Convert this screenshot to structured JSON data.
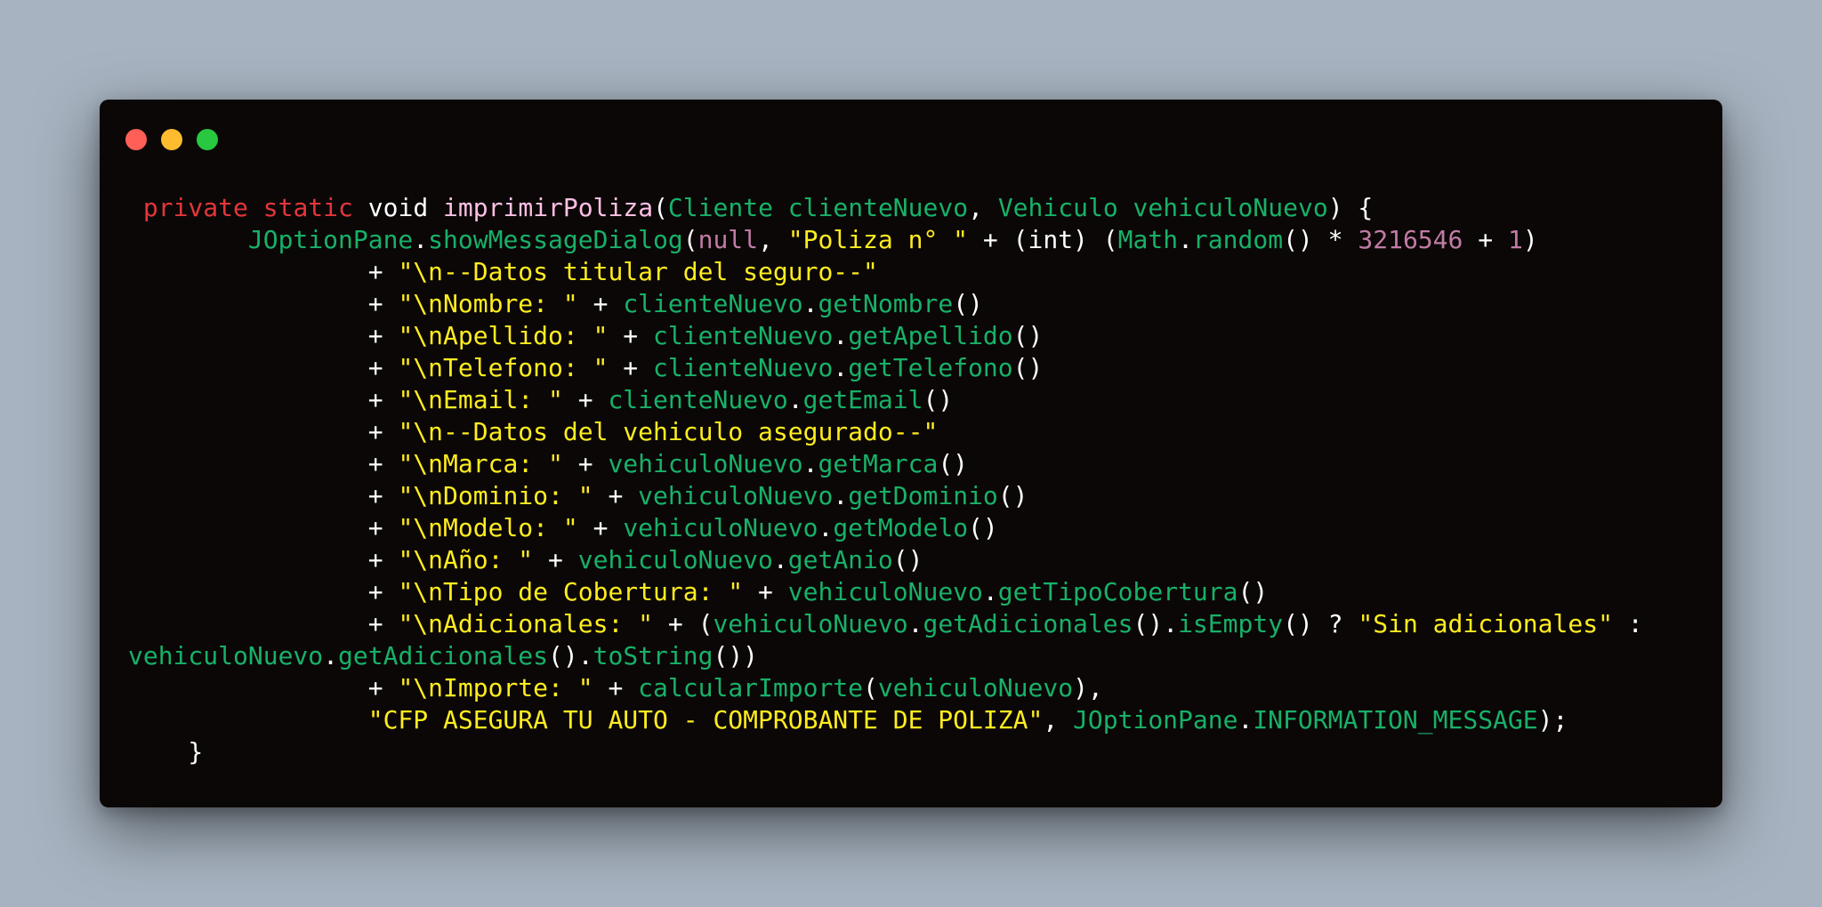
{
  "window": {
    "controls": [
      {
        "name": "close-dot",
        "color": "#ff5f57"
      },
      {
        "name": "minimize-dot",
        "color": "#febc2e"
      },
      {
        "name": "maximize-dot",
        "color": "#28c840"
      }
    ]
  },
  "code": {
    "lines": [
      [
        {
          "t": " "
        },
        {
          "t": "private",
          "c": "kw"
        },
        {
          "t": " "
        },
        {
          "t": "static",
          "c": "kw"
        },
        {
          "t": " "
        },
        {
          "t": "void",
          "c": "type"
        },
        {
          "t": " "
        },
        {
          "t": "imprimirPoliza",
          "c": "fn"
        },
        {
          "t": "(",
          "c": "p"
        },
        {
          "t": "Cliente",
          "c": "cls"
        },
        {
          "t": " "
        },
        {
          "t": "clienteNuevo",
          "c": "var"
        },
        {
          "t": ", ",
          "c": "p"
        },
        {
          "t": "Vehiculo",
          "c": "cls"
        },
        {
          "t": " "
        },
        {
          "t": "vehiculoNuevo",
          "c": "var"
        },
        {
          "t": ") {",
          "c": "p"
        }
      ],
      [
        {
          "t": "        "
        },
        {
          "t": "JOptionPane",
          "c": "cls"
        },
        {
          "t": ".",
          "c": "p"
        },
        {
          "t": "showMessageDialog",
          "c": "var"
        },
        {
          "t": "(",
          "c": "p"
        },
        {
          "t": "null",
          "c": "null"
        },
        {
          "t": ", ",
          "c": "p"
        },
        {
          "t": "\"Poliza n° \"",
          "c": "str"
        },
        {
          "t": " + (int) (",
          "c": "p"
        },
        {
          "t": "Math",
          "c": "cls"
        },
        {
          "t": ".",
          "c": "p"
        },
        {
          "t": "random",
          "c": "var"
        },
        {
          "t": "() * ",
          "c": "p"
        },
        {
          "t": "3216546",
          "c": "num"
        },
        {
          "t": " + ",
          "c": "p"
        },
        {
          "t": "1",
          "c": "num"
        },
        {
          "t": ")",
          "c": "p"
        }
      ],
      [
        {
          "t": "                + ",
          "c": "p"
        },
        {
          "t": "\"\\n--Datos titular del seguro--\"",
          "c": "str"
        }
      ],
      [
        {
          "t": "                + ",
          "c": "p"
        },
        {
          "t": "\"\\nNombre: \"",
          "c": "str"
        },
        {
          "t": " + ",
          "c": "p"
        },
        {
          "t": "clienteNuevo",
          "c": "var"
        },
        {
          "t": ".",
          "c": "p"
        },
        {
          "t": "getNombre",
          "c": "var"
        },
        {
          "t": "()",
          "c": "p"
        }
      ],
      [
        {
          "t": "                + ",
          "c": "p"
        },
        {
          "t": "\"\\nApellido: \"",
          "c": "str"
        },
        {
          "t": " + ",
          "c": "p"
        },
        {
          "t": "clienteNuevo",
          "c": "var"
        },
        {
          "t": ".",
          "c": "p"
        },
        {
          "t": "getApellido",
          "c": "var"
        },
        {
          "t": "()",
          "c": "p"
        }
      ],
      [
        {
          "t": "                + ",
          "c": "p"
        },
        {
          "t": "\"\\nTelefono: \"",
          "c": "str"
        },
        {
          "t": " + ",
          "c": "p"
        },
        {
          "t": "clienteNuevo",
          "c": "var"
        },
        {
          "t": ".",
          "c": "p"
        },
        {
          "t": "getTelefono",
          "c": "var"
        },
        {
          "t": "()",
          "c": "p"
        }
      ],
      [
        {
          "t": "                + ",
          "c": "p"
        },
        {
          "t": "\"\\nEmail: \"",
          "c": "str"
        },
        {
          "t": " + ",
          "c": "p"
        },
        {
          "t": "clienteNuevo",
          "c": "var"
        },
        {
          "t": ".",
          "c": "p"
        },
        {
          "t": "getEmail",
          "c": "var"
        },
        {
          "t": "()",
          "c": "p"
        }
      ],
      [
        {
          "t": "                + ",
          "c": "p"
        },
        {
          "t": "\"\\n--Datos del vehiculo asegurado--\"",
          "c": "str"
        }
      ],
      [
        {
          "t": "                + ",
          "c": "p"
        },
        {
          "t": "\"\\nMarca: \"",
          "c": "str"
        },
        {
          "t": " + ",
          "c": "p"
        },
        {
          "t": "vehiculoNuevo",
          "c": "var"
        },
        {
          "t": ".",
          "c": "p"
        },
        {
          "t": "getMarca",
          "c": "var"
        },
        {
          "t": "()",
          "c": "p"
        }
      ],
      [
        {
          "t": "                + ",
          "c": "p"
        },
        {
          "t": "\"\\nDominio: \"",
          "c": "str"
        },
        {
          "t": " + ",
          "c": "p"
        },
        {
          "t": "vehiculoNuevo",
          "c": "var"
        },
        {
          "t": ".",
          "c": "p"
        },
        {
          "t": "getDominio",
          "c": "var"
        },
        {
          "t": "()",
          "c": "p"
        }
      ],
      [
        {
          "t": "                + ",
          "c": "p"
        },
        {
          "t": "\"\\nModelo: \"",
          "c": "str"
        },
        {
          "t": " + ",
          "c": "p"
        },
        {
          "t": "vehiculoNuevo",
          "c": "var"
        },
        {
          "t": ".",
          "c": "p"
        },
        {
          "t": "getModelo",
          "c": "var"
        },
        {
          "t": "()",
          "c": "p"
        }
      ],
      [
        {
          "t": "                + ",
          "c": "p"
        },
        {
          "t": "\"\\nAño: \"",
          "c": "str"
        },
        {
          "t": " + ",
          "c": "p"
        },
        {
          "t": "vehiculoNuevo",
          "c": "var"
        },
        {
          "t": ".",
          "c": "p"
        },
        {
          "t": "getAnio",
          "c": "var"
        },
        {
          "t": "()",
          "c": "p"
        }
      ],
      [
        {
          "t": "                + ",
          "c": "p"
        },
        {
          "t": "\"\\nTipo de Cobertura: \"",
          "c": "str"
        },
        {
          "t": " + ",
          "c": "p"
        },
        {
          "t": "vehiculoNuevo",
          "c": "var"
        },
        {
          "t": ".",
          "c": "p"
        },
        {
          "t": "getTipoCobertura",
          "c": "var"
        },
        {
          "t": "()",
          "c": "p"
        }
      ],
      [
        {
          "t": "                + ",
          "c": "p"
        },
        {
          "t": "\"\\nAdicionales: \"",
          "c": "str"
        },
        {
          "t": " + (",
          "c": "p"
        },
        {
          "t": "vehiculoNuevo",
          "c": "var"
        },
        {
          "t": ".",
          "c": "p"
        },
        {
          "t": "getAdicionales",
          "c": "var"
        },
        {
          "t": "().",
          "c": "p"
        },
        {
          "t": "isEmpty",
          "c": "var"
        },
        {
          "t": "() ? ",
          "c": "p"
        },
        {
          "t": "\"Sin adicionales\"",
          "c": "str"
        },
        {
          "t": " :",
          "c": "p"
        }
      ],
      [
        {
          "t": "vehiculoNuevo",
          "c": "var"
        },
        {
          "t": ".",
          "c": "p"
        },
        {
          "t": "getAdicionales",
          "c": "var"
        },
        {
          "t": "().",
          "c": "p"
        },
        {
          "t": "toString",
          "c": "var"
        },
        {
          "t": "())",
          "c": "p"
        }
      ],
      [
        {
          "t": "                + ",
          "c": "p"
        },
        {
          "t": "\"\\nImporte: \"",
          "c": "str"
        },
        {
          "t": " + ",
          "c": "p"
        },
        {
          "t": "calcularImporte",
          "c": "var"
        },
        {
          "t": "(",
          "c": "p"
        },
        {
          "t": "vehiculoNuevo",
          "c": "var"
        },
        {
          "t": "),",
          "c": "p"
        }
      ],
      [
        {
          "t": "                "
        },
        {
          "t": "\"CFP ASEGURA TU AUTO - COMPROBANTE DE POLIZA\"",
          "c": "str"
        },
        {
          "t": ", ",
          "c": "p"
        },
        {
          "t": "JOptionPane",
          "c": "cls"
        },
        {
          "t": ".",
          "c": "p"
        },
        {
          "t": "INFORMATION_MESSAGE",
          "c": "var"
        },
        {
          "t": ");",
          "c": "p"
        }
      ],
      [
        {
          "t": "    }",
          "c": "p"
        }
      ]
    ]
  }
}
